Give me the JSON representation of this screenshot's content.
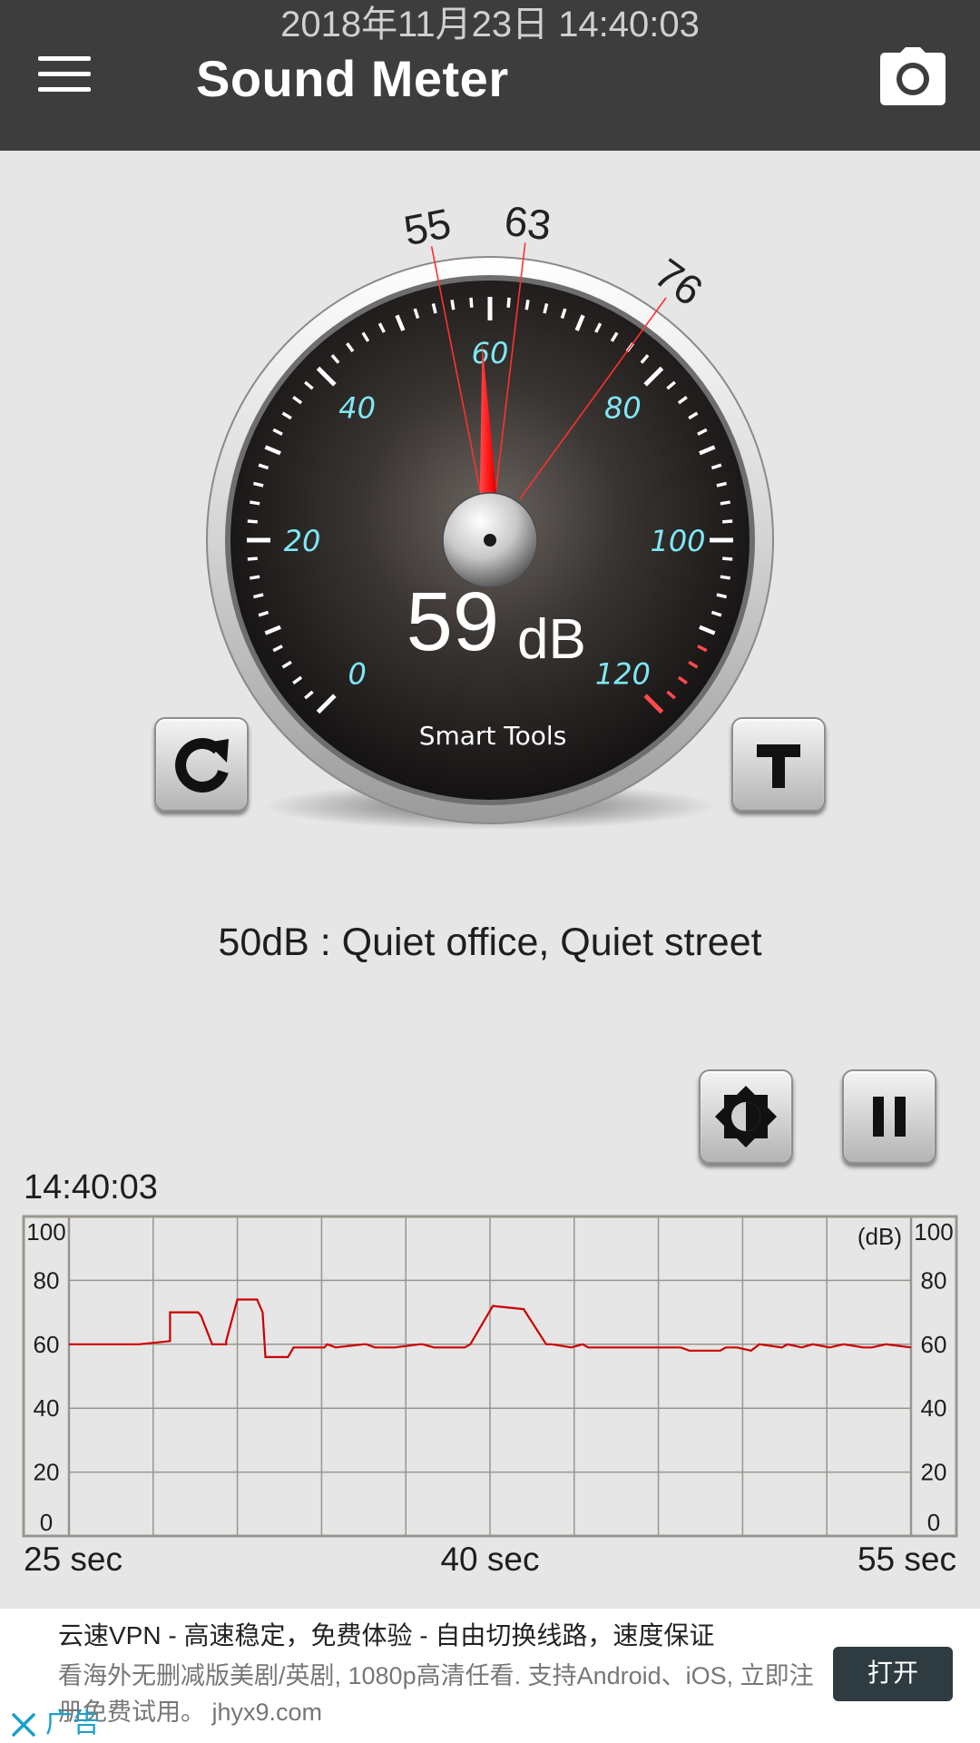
{
  "status_bar": {
    "datetime": "2018年11月23日 14:40:03"
  },
  "app_bar": {
    "title": "Sound Meter",
    "menu_icon": "hamburger-menu-icon",
    "camera_icon": "camera-icon"
  },
  "gauge": {
    "value": 59,
    "value_text": "59",
    "unit": "dB",
    "brand": "Smart Tools",
    "min": 0,
    "max": 120,
    "scale_labels": [
      "0",
      "20",
      "40",
      "60",
      "80",
      "100",
      "120"
    ],
    "markers": [
      {
        "value": 55,
        "label": "55"
      },
      {
        "value": 63,
        "label": "63"
      },
      {
        "value": 76,
        "label": "76"
      }
    ],
    "reset_icon": "refresh-icon",
    "text_icon": "text-t-icon",
    "colors": {
      "scale_text": "#7fe8f5",
      "needle": "#ff1a1a",
      "danger_ticks": "#ff4a4a",
      "face": "#232020"
    }
  },
  "level_description": "50dB : Quiet office, Quiet street",
  "controls": {
    "brightness_icon": "brightness-icon",
    "pause_icon": "pause-icon"
  },
  "chart_time": "14:40:03",
  "chart_data": {
    "type": "line",
    "title": "",
    "xlabel": "",
    "ylabel": "(dB)",
    "x_tick_labels": [
      "25 sec",
      "40 sec",
      "55 sec"
    ],
    "y_tick_labels": [
      "100",
      "80",
      "60",
      "40",
      "20",
      "0"
    ],
    "xlim": [
      25,
      55
    ],
    "ylim": [
      0,
      100
    ],
    "grid": true,
    "series": [
      {
        "color": "#cc0000",
        "x": [
          25,
          27,
          27.5,
          28.6,
          28.6,
          29.6,
          29.7,
          30.1,
          30.6,
          30.6,
          31.0,
          31.7,
          31.9,
          32.0,
          32.8,
          33.0,
          34.1,
          34.2,
          34.5,
          35.5,
          35.6,
          35.9,
          36.6,
          37.5,
          37.6,
          38.0,
          38.6,
          39.1,
          39.3,
          40.1,
          41.2,
          42.0,
          42.2,
          42.9,
          43.3,
          43.5,
          46.8,
          47.1,
          48.2,
          48.4,
          48.8,
          49.3,
          49.6,
          50.4,
          50.6,
          51.1,
          51.5,
          52.1,
          52.6,
          53.3,
          53.6,
          54.1,
          55
        ],
        "y": [
          60,
          60,
          60,
          61,
          70,
          70,
          69,
          60,
          60,
          61,
          74,
          74,
          70,
          56,
          56,
          59,
          59,
          60,
          59,
          60,
          60,
          59,
          59,
          60,
          60,
          59,
          59,
          59,
          60,
          72,
          71,
          60,
          60,
          59,
          60,
          59,
          59,
          58,
          58,
          59,
          59,
          58,
          60,
          59,
          60,
          59,
          60,
          59,
          60,
          59,
          59,
          60,
          59
        ]
      }
    ]
  },
  "ad": {
    "title": "云速VPN - 高速稳定，免费体验 - 自由切换线路，速度保证",
    "description": "看海外无删减版美剧/英剧, 1080p高清任看. 支持Android、iOS, 立即注册免费试用。 jhyx9.com",
    "open_label": "打开",
    "ad_label": "广告",
    "close_icon": "close-icon"
  }
}
